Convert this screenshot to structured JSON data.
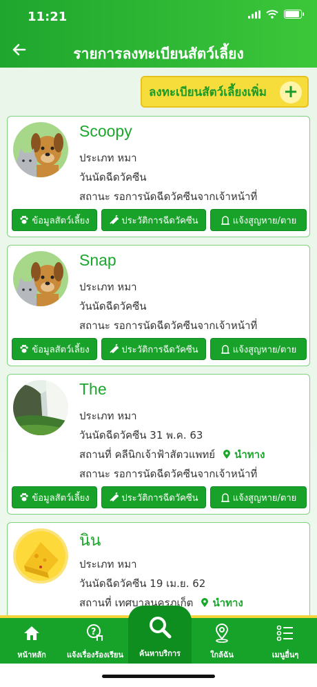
{
  "status_bar": {
    "time": "11:21"
  },
  "header": {
    "title": "รายการลงทะเบียนสัตว์เลี้ยง"
  },
  "add_button": {
    "label": "ลงทะเบียนสัตว์เลี้ยงเพิ่ม"
  },
  "labels": {
    "type_prefix": "ประเภท",
    "vaccine_prefix": "วันนัดฉีดวัคซีน",
    "place_prefix": "สถานที่",
    "status_prefix": "สถานะ",
    "navigate": "นำทาง"
  },
  "actions": {
    "pet_info": "ข้อมูลสัตว์เลี้ยง",
    "vaccine_history": "ประวัติการฉีดวัคซีน",
    "report_lost": "แจ้งสูญหาย/ตาย"
  },
  "pets": [
    {
      "name": "Scoopy",
      "type": "ประเภท หมา",
      "vaccine": "วันนัดฉีดวัคซีน",
      "status": "สถานะ รอการนัดฉีดวัคซีนจากเจ้าหน้าที่"
    },
    {
      "name": "Snap",
      "type": "ประเภท หมา",
      "vaccine": "วันนัดฉีดวัคซีน",
      "status": "สถานะ รอการนัดฉีดวัคซีนจากเจ้าหน้าที่"
    },
    {
      "name": "The",
      "type": "ประเภท หมา",
      "vaccine": "วันนัดฉีดวัคซีน 31 พ.ค. 63",
      "place": "สถานที่ คลีนิกเจ้าฟ้าสัตวแพทย์",
      "status": "สถานะ รอการนัดฉีดวัคซีนจากเจ้าหน้าที่"
    },
    {
      "name": "นิน",
      "type": "ประเภท หมา",
      "vaccine": "วันนัดฉีดวัคซีน 19 เม.ย. 62",
      "place": "สถานที่ เทศบาลนครภูเก็ต"
    }
  ],
  "tabs": [
    {
      "label": "หน้าหลัก",
      "icon": "home-icon"
    },
    {
      "label": "แจ้งเรื่องร้องเรียน",
      "icon": "help-touch-icon"
    },
    {
      "label": "ค้นหาบริการ",
      "icon": "search-icon"
    },
    {
      "label": "ใกล้ฉัน",
      "icon": "location-pin-icon"
    },
    {
      "label": "เมนูอื่นๆ",
      "icon": "menu-list-icon"
    }
  ],
  "colors": {
    "primary": "#18a22a",
    "accent": "#f6dd3b"
  }
}
